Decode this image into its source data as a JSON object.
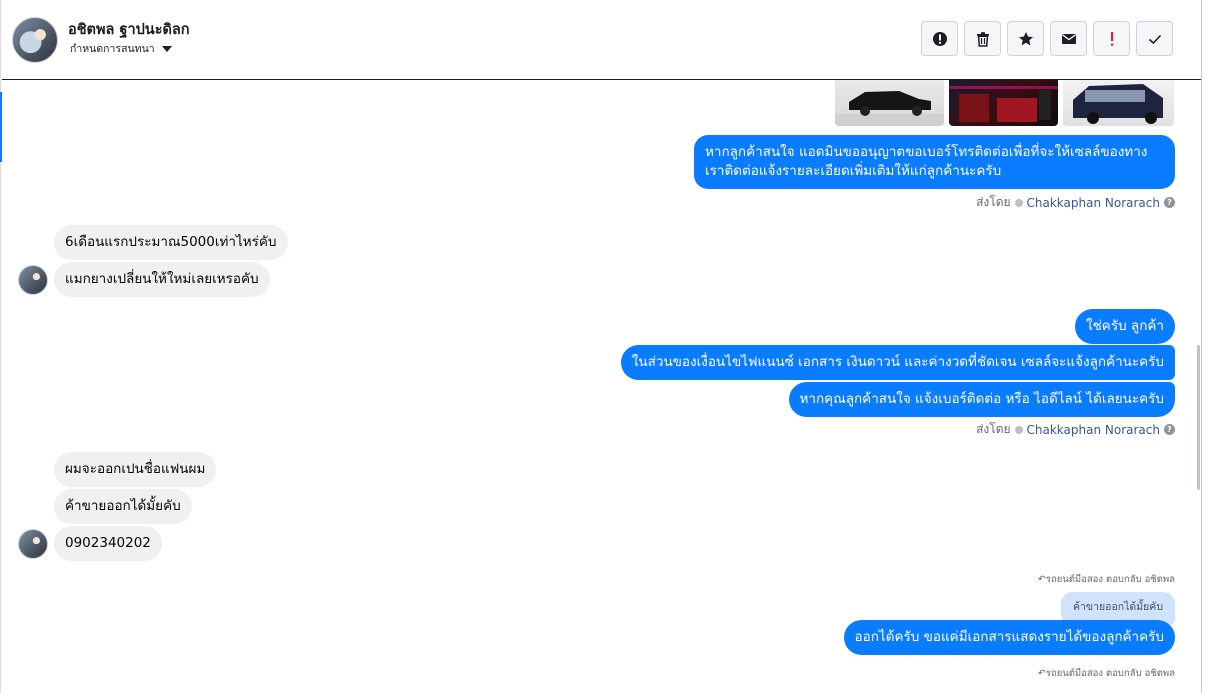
{
  "header": {
    "name": "อชิตพล ฐาปนะดิลก",
    "subtitle": "กำหนดการสนทนา",
    "toolbar": [
      {
        "icon": "alert-circle-icon"
      },
      {
        "icon": "trash-icon"
      },
      {
        "icon": "star-icon"
      },
      {
        "icon": "envelope-icon"
      },
      {
        "icon": "exclamation-icon",
        "color": "#e4222b"
      },
      {
        "icon": "checkmark-icon"
      }
    ]
  },
  "messages": {
    "out1": "หากลูกค้าสนใจ แอดมินขออนุญาตขอเบอร์โทรติดต่อเพื่อที่จะให้เซลล์ของทางเราติดต่อแจ้งรายละเอียดเพิ่มเติมให้แก่ลูกค้านะครับ",
    "in1": "6เดือนแรกประมาณ5000เท่าไหร่คับ",
    "in2": "แมกยางเปลี่ยนให้ใหม่เลยเหรอคับ",
    "out2": "ใช่ครับ ลูกค้า",
    "out3": "ในส่วนของเงื่อนไขไฟแนนซ์ เอกสาร เงินดาวน์ และค่างวดที่ชัดเจน เซลล์จะแจ้งลูกค้านะครับ",
    "out4": "หากคุณลูกค้าสนใจ แจ้งเบอร์ติดต่อ หรือ ไอดีไลน์ ได้เลยนะครับ",
    "in3": "ผมจะออกเปนชื่อแฟนผม",
    "in4": "ค้าขายออกได้มั้ยคับ",
    "in5": "0902340202",
    "reply_meta": "↶รถยนต์มือสอง ตอบกลับ อชิตพล",
    "quoted": "ค้าขายออกได้มั้ยคับ",
    "out5": "ออกได้ครับ ขอแค่มีเอกสารแสดงรายได้ของลูกค้าครับ",
    "reply_meta2": "↶รถยนต์มือสอง ตอบกลับ อชิตพล"
  },
  "sent_by": {
    "label": "ส่งโดย",
    "agent": "Chakkaphan Norarach",
    "help": "?"
  },
  "colors": {
    "outgoing": "#0a7cff",
    "incoming": "#f0f0f0",
    "quoted": "#cfe3ff"
  }
}
